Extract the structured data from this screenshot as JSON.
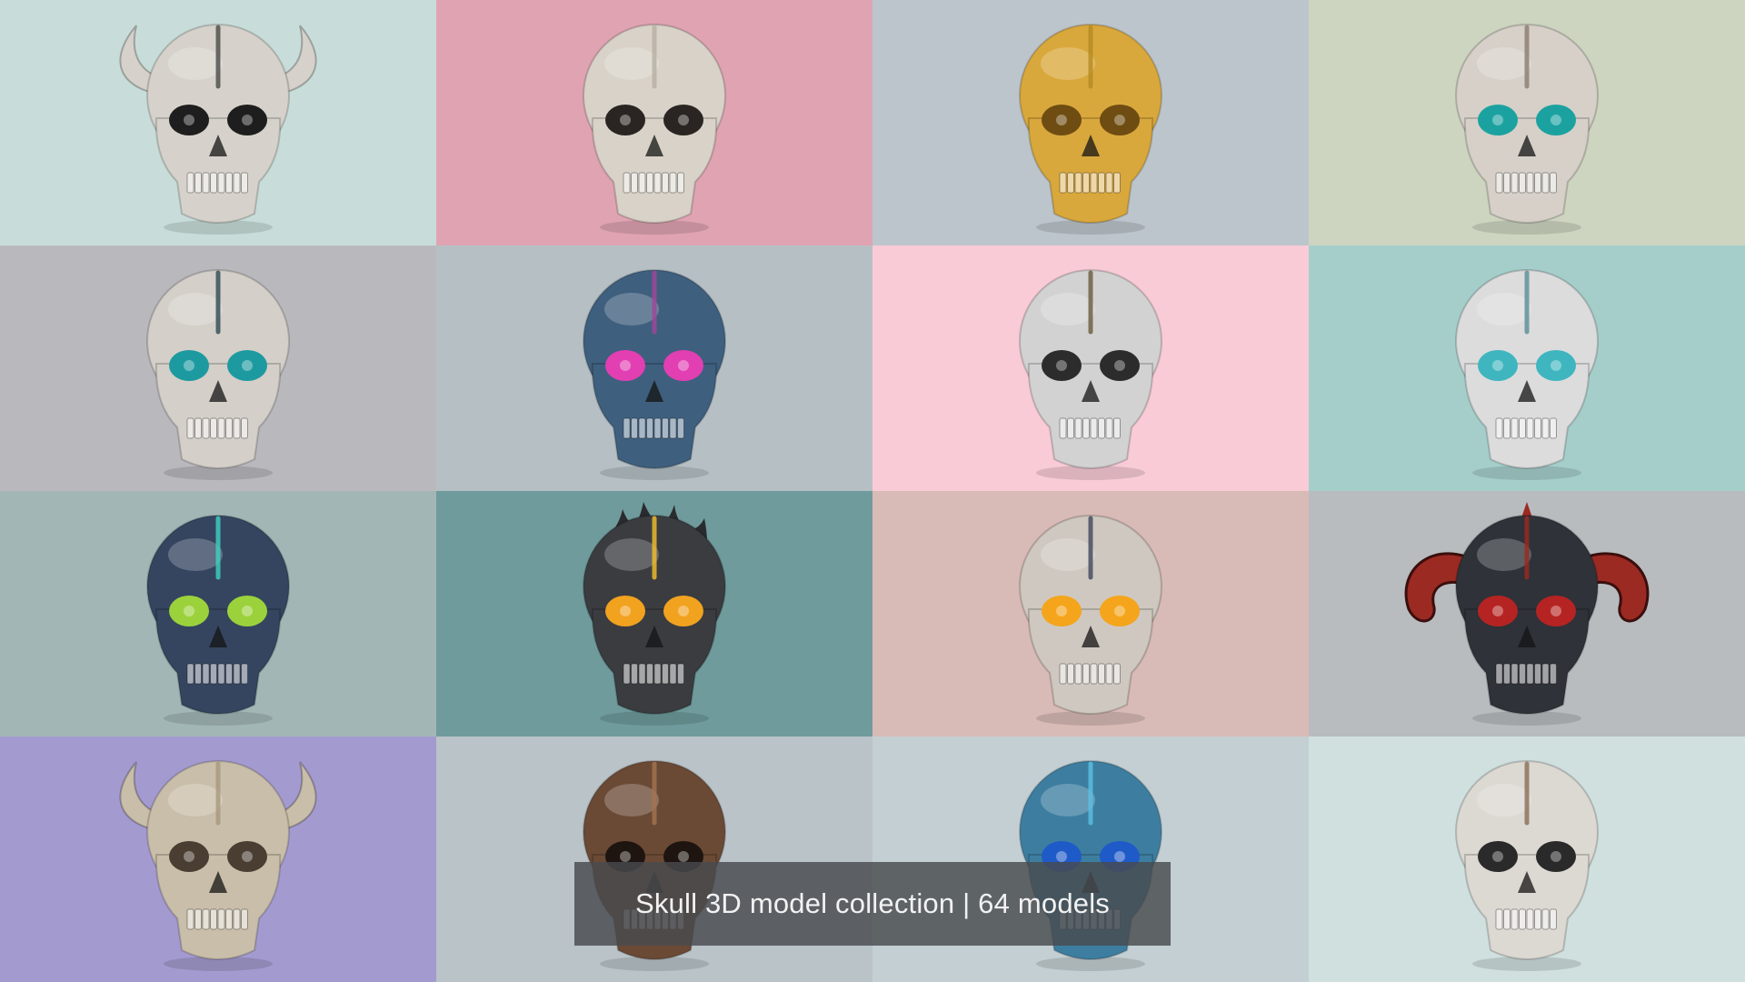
{
  "caption": "Skull 3D model collection | 64 models",
  "tiles": [
    {
      "bg": "#c8ddd9",
      "skull": "#d6d2cb",
      "eye": "#1e1e1e",
      "accent": "#4a4a4a",
      "horns": "up"
    },
    {
      "bg": "#dfa3b2",
      "skull": "#d8d2c8",
      "eye": "#2a2522",
      "accent": "#b8b0a4",
      "horns": "none"
    },
    {
      "bg": "#bcc5cb",
      "skull": "#d9a83c",
      "eye": "#6e4c12",
      "accent": "#b58b22",
      "horns": "none"
    },
    {
      "bg": "#cdd5c0",
      "skull": "#d6d0c8",
      "eye": "#1ba2a0",
      "accent": "#8a7d72",
      "horns": "none"
    },
    {
      "bg": "#b9b9bd",
      "skull": "#d4cfc8",
      "eye": "#1d9aa0",
      "accent": "#2e4a55",
      "horns": "none"
    },
    {
      "bg": "#b6c0c4",
      "skull": "#3f5f7e",
      "eye": "#e23fb3",
      "accent": "#a2469b",
      "horns": "none"
    },
    {
      "bg": "#f8cbd6",
      "skull": "#d2d2d2",
      "eye": "#2c2c2c",
      "accent": "#6b5a3d",
      "horns": "none"
    },
    {
      "bg": "#a5cecb",
      "skull": "#dcdcdc",
      "eye": "#3fb6bf",
      "accent": "#5a8e95",
      "horns": "none"
    },
    {
      "bg": "#a2b7b5",
      "skull": "#35455f",
      "eye": "#9bd23c",
      "accent": "#3dd4c3",
      "horns": "none"
    },
    {
      "bg": "#6f9b9c",
      "skull": "#3a3c40",
      "eye": "#f1a21f",
      "accent": "#f6c12b",
      "horns": "flame"
    },
    {
      "bg": "#d8bab6",
      "skull": "#cfc8c0",
      "eye": "#f4a51c",
      "accent": "#40485c",
      "horns": "none"
    },
    {
      "bg": "#b8bcbf",
      "skull": "#2f3238",
      "eye": "#b52422",
      "accent": "#9b2a22",
      "horns": "ram"
    },
    {
      "bg": "#a39bcf",
      "skull": "#c9bea9",
      "eye": "#4a3e33",
      "accent": "#a8997e",
      "horns": "up"
    },
    {
      "bg": "#b9c3c8",
      "skull": "#6b4a35",
      "eye": "#1e1510",
      "accent": "#a47451",
      "horns": "none"
    },
    {
      "bg": "#c3cfd2",
      "skull": "#3d7ea0",
      "eye": "#1f5ac9",
      "accent": "#5cc1e3",
      "horns": "none"
    },
    {
      "bg": "#cfe0df",
      "skull": "#dcd8d2",
      "eye": "#2a2a2a",
      "accent": "#8a6e58",
      "horns": "none"
    }
  ]
}
